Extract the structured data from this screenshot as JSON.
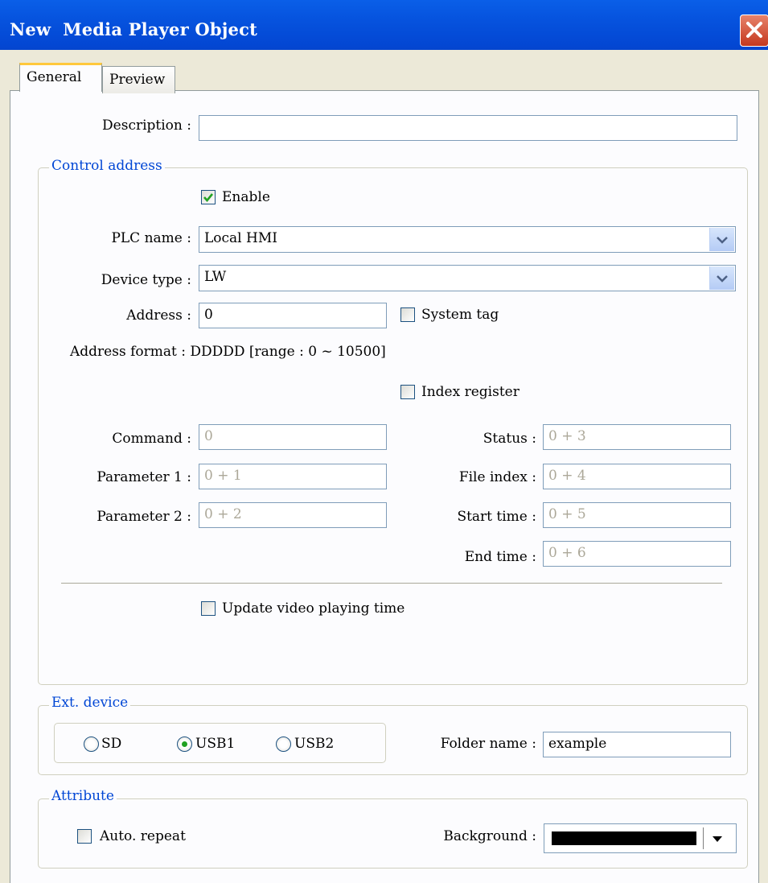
{
  "window": {
    "title": "New  Media Player Object"
  },
  "tabs": [
    {
      "label": "General"
    },
    {
      "label": "Preview"
    }
  ],
  "description": {
    "label": "Description :",
    "value": ""
  },
  "control_address": {
    "title": "Control address",
    "enable": {
      "label": "Enable",
      "checked": true
    },
    "plc_name": {
      "label": "PLC name :",
      "value": "Local HMI"
    },
    "device_type": {
      "label": "Device type :",
      "value": "LW"
    },
    "address": {
      "label": "Address :",
      "value": "0"
    },
    "system_tag": {
      "label": "System tag",
      "checked": false
    },
    "address_format": "Address format : DDDDD [range : 0 ~ 10500]",
    "index_register": {
      "label": "Index register",
      "checked": false
    },
    "command": {
      "label": "Command :",
      "value": "0"
    },
    "parameter1": {
      "label": "Parameter 1 :",
      "value": "0 + 1"
    },
    "parameter2": {
      "label": "Parameter 2 :",
      "value": "0 + 2"
    },
    "status": {
      "label": "Status :",
      "value": "0 + 3"
    },
    "file_index": {
      "label": "File index :",
      "value": "0 + 4"
    },
    "start_time": {
      "label": "Start time :",
      "value": "0 + 5"
    },
    "end_time": {
      "label": "End time :",
      "value": "0 + 6"
    },
    "update_video": {
      "label": "Update video playing time",
      "checked": false
    }
  },
  "ext_device": {
    "title": "Ext. device",
    "options": [
      {
        "label": "SD"
      },
      {
        "label": "USB1"
      },
      {
        "label": "USB2"
      }
    ],
    "selected": "USB1",
    "folder_name": {
      "label": "Folder name :",
      "value": "example"
    }
  },
  "attribute": {
    "title": "Attribute",
    "auto_repeat": {
      "label": "Auto. repeat",
      "checked": false
    },
    "background": {
      "label": "Background :",
      "color": "#000000"
    }
  },
  "colors": {
    "title_bar": "#0653de",
    "group_title": "#0046d5",
    "checkmark": "#21a121",
    "close_button": "#c4381e"
  }
}
